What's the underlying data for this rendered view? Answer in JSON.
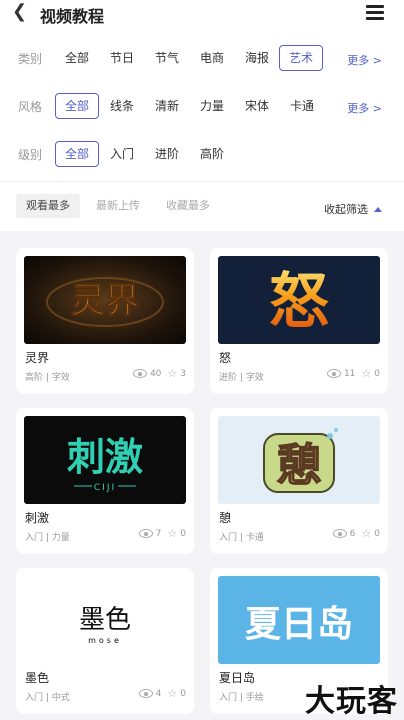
{
  "header": {
    "title": "视频教程"
  },
  "filters": {
    "category": {
      "label": "类别",
      "options": [
        "全部",
        "节日",
        "节气",
        "电商",
        "海报",
        "艺术"
      ],
      "selected": "艺术",
      "more": "更多 >"
    },
    "style": {
      "label": "风格",
      "options": [
        "全部",
        "线条",
        "清新",
        "力量",
        "宋体",
        "卡通"
      ],
      "selected": "全部",
      "more": "更多 >"
    },
    "level": {
      "label": "级别",
      "options": [
        "全部",
        "入门",
        "进阶",
        "高阶"
      ],
      "selected": "全部"
    }
  },
  "sort": {
    "options": [
      "观看最多",
      "最新上传",
      "收藏最多"
    ],
    "selected": "观看最多",
    "collapse": "收起筛选"
  },
  "cards": [
    {
      "name": "灵界",
      "level": "高阶",
      "type": "字效",
      "views": "40",
      "stars": "3",
      "thumb_text": "灵界"
    },
    {
      "name": "怒",
      "level": "进阶",
      "type": "字效",
      "views": "11",
      "stars": "0",
      "thumb_text": "怒"
    },
    {
      "name": "刺激",
      "level": "入门",
      "type": "力量",
      "views": "7",
      "stars": "0",
      "thumb_text": "刺激",
      "thumb_sub": "CIJI"
    },
    {
      "name": "憩",
      "level": "入门",
      "type": "卡通",
      "views": "6",
      "stars": "0",
      "thumb_text": "憩"
    },
    {
      "name": "墨色",
      "level": "入门",
      "type": "中式",
      "views": "4",
      "stars": "0",
      "thumb_text": "墨色",
      "thumb_sub": "mose"
    },
    {
      "name": "夏日岛",
      "level": "入门",
      "type": "手绘",
      "views": "",
      "stars": "",
      "thumb_text": "夏日岛"
    }
  ],
  "watermark": "大玩客",
  "colors": {
    "accent": "#5561c9",
    "grid_bg": "#f4f4f6"
  }
}
